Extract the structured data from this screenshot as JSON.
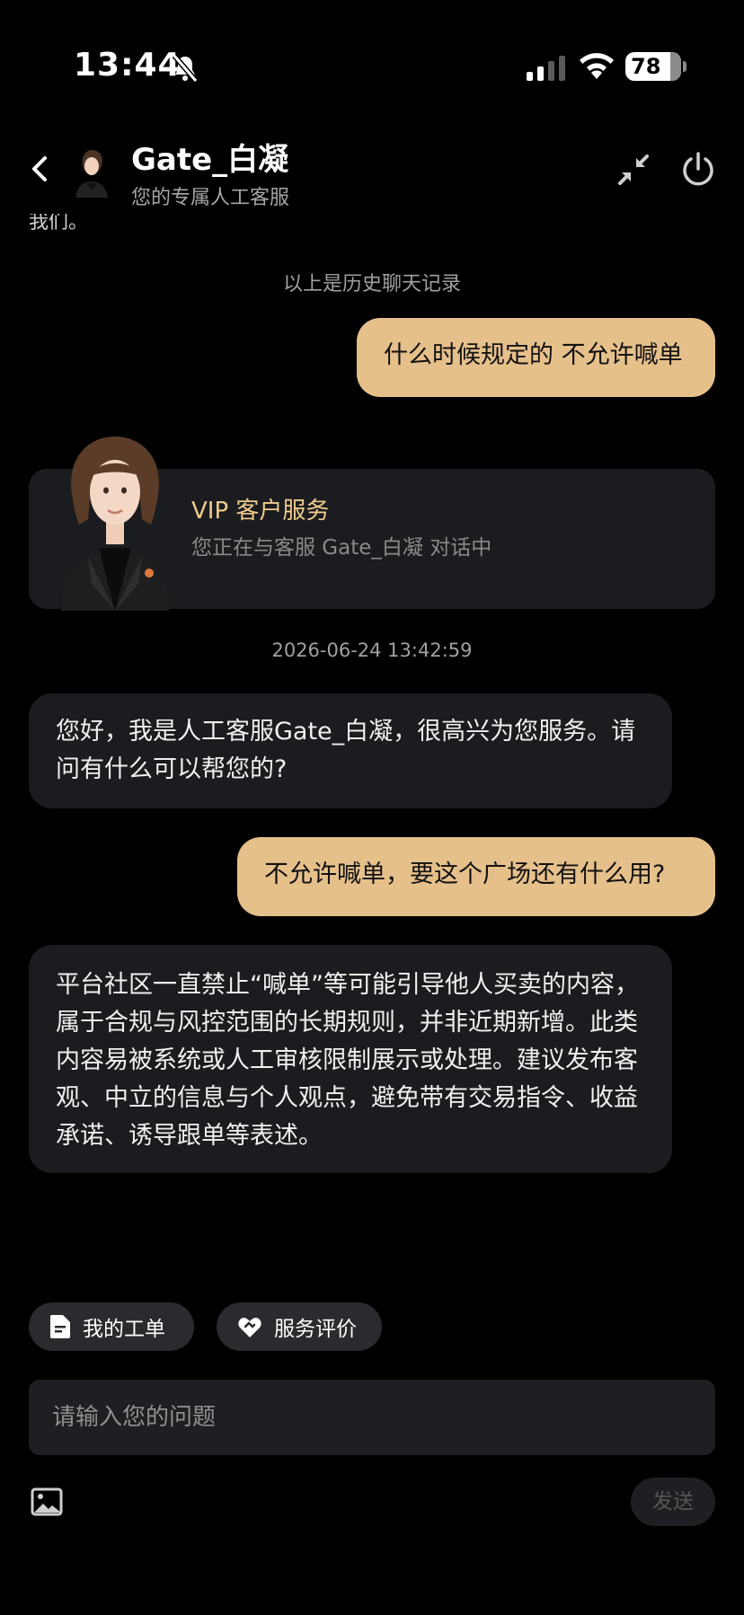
{
  "status_bar": {
    "time": "13:44",
    "battery": "78"
  },
  "header": {
    "agent_name": "Gate_白凝",
    "subtitle": "您的专属人工客服"
  },
  "clipped_text": "我们。",
  "history_divider": "以上是历史聊天记录",
  "messages": [
    {
      "side": "user",
      "text": "什么时候规定的 不允许喊单"
    },
    {
      "side": "agent",
      "text": "您好，我是人工客服Gate_白凝，很高兴为您服务。请问有什么可以帮您的?"
    },
    {
      "side": "user",
      "text": "不允许喊单，要这个广场还有什么用?"
    },
    {
      "side": "agent",
      "text": "平台社区一直禁止“喊单”等可能引导他人买卖的内容，属于合规与风控范围的长期规则，并非近期新增。此类内容易被系统或人工审核限制展示或处理。建议发布客观、中立的信息与个人观点，避免带有交易指令、收益承诺、诱导跟单等表述。"
    }
  ],
  "vip_card": {
    "title": "VIP 客户服务",
    "subtitle": "您正在与客服 Gate_白凝 对话中"
  },
  "timestamp": "2026-06-24 13:42:59",
  "quick_actions": [
    {
      "label": "我的工单",
      "icon": "document-icon"
    },
    {
      "label": "服务评价",
      "icon": "heart-handshake-icon"
    }
  ],
  "input": {
    "placeholder": "请输入您的问题"
  },
  "send_label": "发送",
  "colors": {
    "accent": "#e6c08a",
    "bubble_agent": "#1b1c1f",
    "vip_title": "#f0cc8e",
    "background": "#000000"
  }
}
